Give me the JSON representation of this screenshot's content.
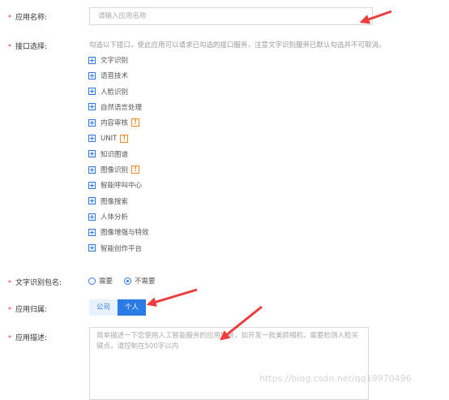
{
  "form": {
    "name_label": "应用名称:",
    "name_placeholder": "请输入应用名称",
    "api_label": "接口选择:",
    "api_hint": "勾选以下接口，使此应用可以请求已勾选的接口服务，注意文字识别服务已默认勾选并不可取消。",
    "services": [
      {
        "label": "文字识别"
      },
      {
        "label": "语音技术"
      },
      {
        "label": "人脸识别"
      },
      {
        "label": "自然语言处理"
      },
      {
        "label": "内容审核",
        "warn": "!"
      },
      {
        "label": "UNIT",
        "warn": "!"
      },
      {
        "label": "知识图谱"
      },
      {
        "label": "图像识别",
        "warn": "!"
      },
      {
        "label": "智能呼叫中心"
      },
      {
        "label": "图像搜索"
      },
      {
        "label": "人体分析"
      },
      {
        "label": "图像增强与特效"
      },
      {
        "label": "智能创作平台"
      }
    ],
    "pkg_label": "文字识别包名:",
    "pkg_options": {
      "need": "需要",
      "not_need": "不需要",
      "selected": "不需要"
    },
    "owner_label": "应用归属:",
    "owner_options": {
      "company": "公司",
      "personal": "个人",
      "selected": "个人"
    },
    "desc_label": "应用描述:",
    "desc_placeholder": "简单描述一下您使用人工智能服务的应用场景，如开发一款美颜相机，需要检测人脸关键点，请控制在500字以内"
  },
  "watermark": "https://blog.csdn.net/qq19970496",
  "colors": {
    "primary": "#2c7be5",
    "required": "#f5222d",
    "warn": "#f08a24",
    "arrow": "#f03b3b"
  }
}
